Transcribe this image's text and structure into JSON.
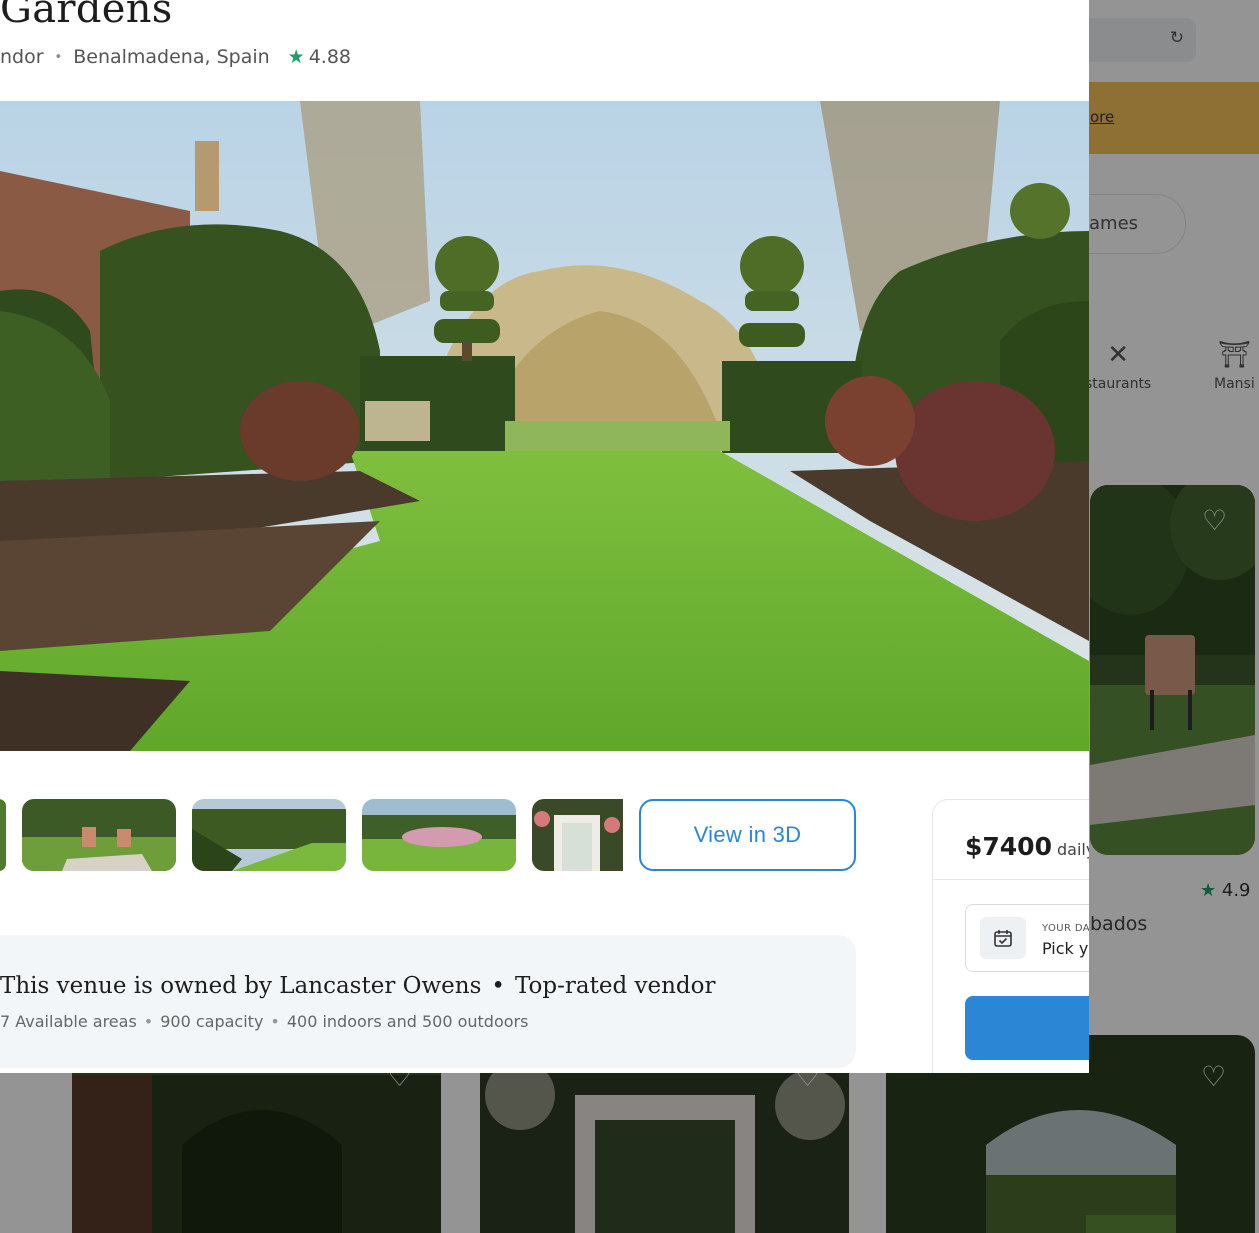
{
  "background": {
    "banner_link": "ore",
    "pill_label": "ames",
    "categories": [
      {
        "label": "staurants",
        "icon": "utensils-icon"
      },
      {
        "label": "Mansi",
        "icon": "mansion-icon"
      }
    ],
    "card_rating": "4.9",
    "card_title": "bados"
  },
  "venue": {
    "title": "Gardens",
    "type": "ndor",
    "location": "Benalmadena, Spain",
    "rating": "4.88"
  },
  "gallery": {
    "view_3d_label": "View in 3D"
  },
  "owner": {
    "title": "This venue is owned by Lancaster Owens",
    "badge": "Top-rated vendor",
    "areas": "7 Available areas",
    "capacity": "900 capacity",
    "split": "400 indoors and 500 outdoors"
  },
  "booking": {
    "price": "$7400",
    "period": "daily",
    "date_label": "YOUR DATE",
    "date_placeholder": "Pick yo"
  },
  "colors": {
    "accent_blue": "#2c86d6",
    "rating_star": "#1f9d6b",
    "banner_yellow": "#f5c05a"
  }
}
